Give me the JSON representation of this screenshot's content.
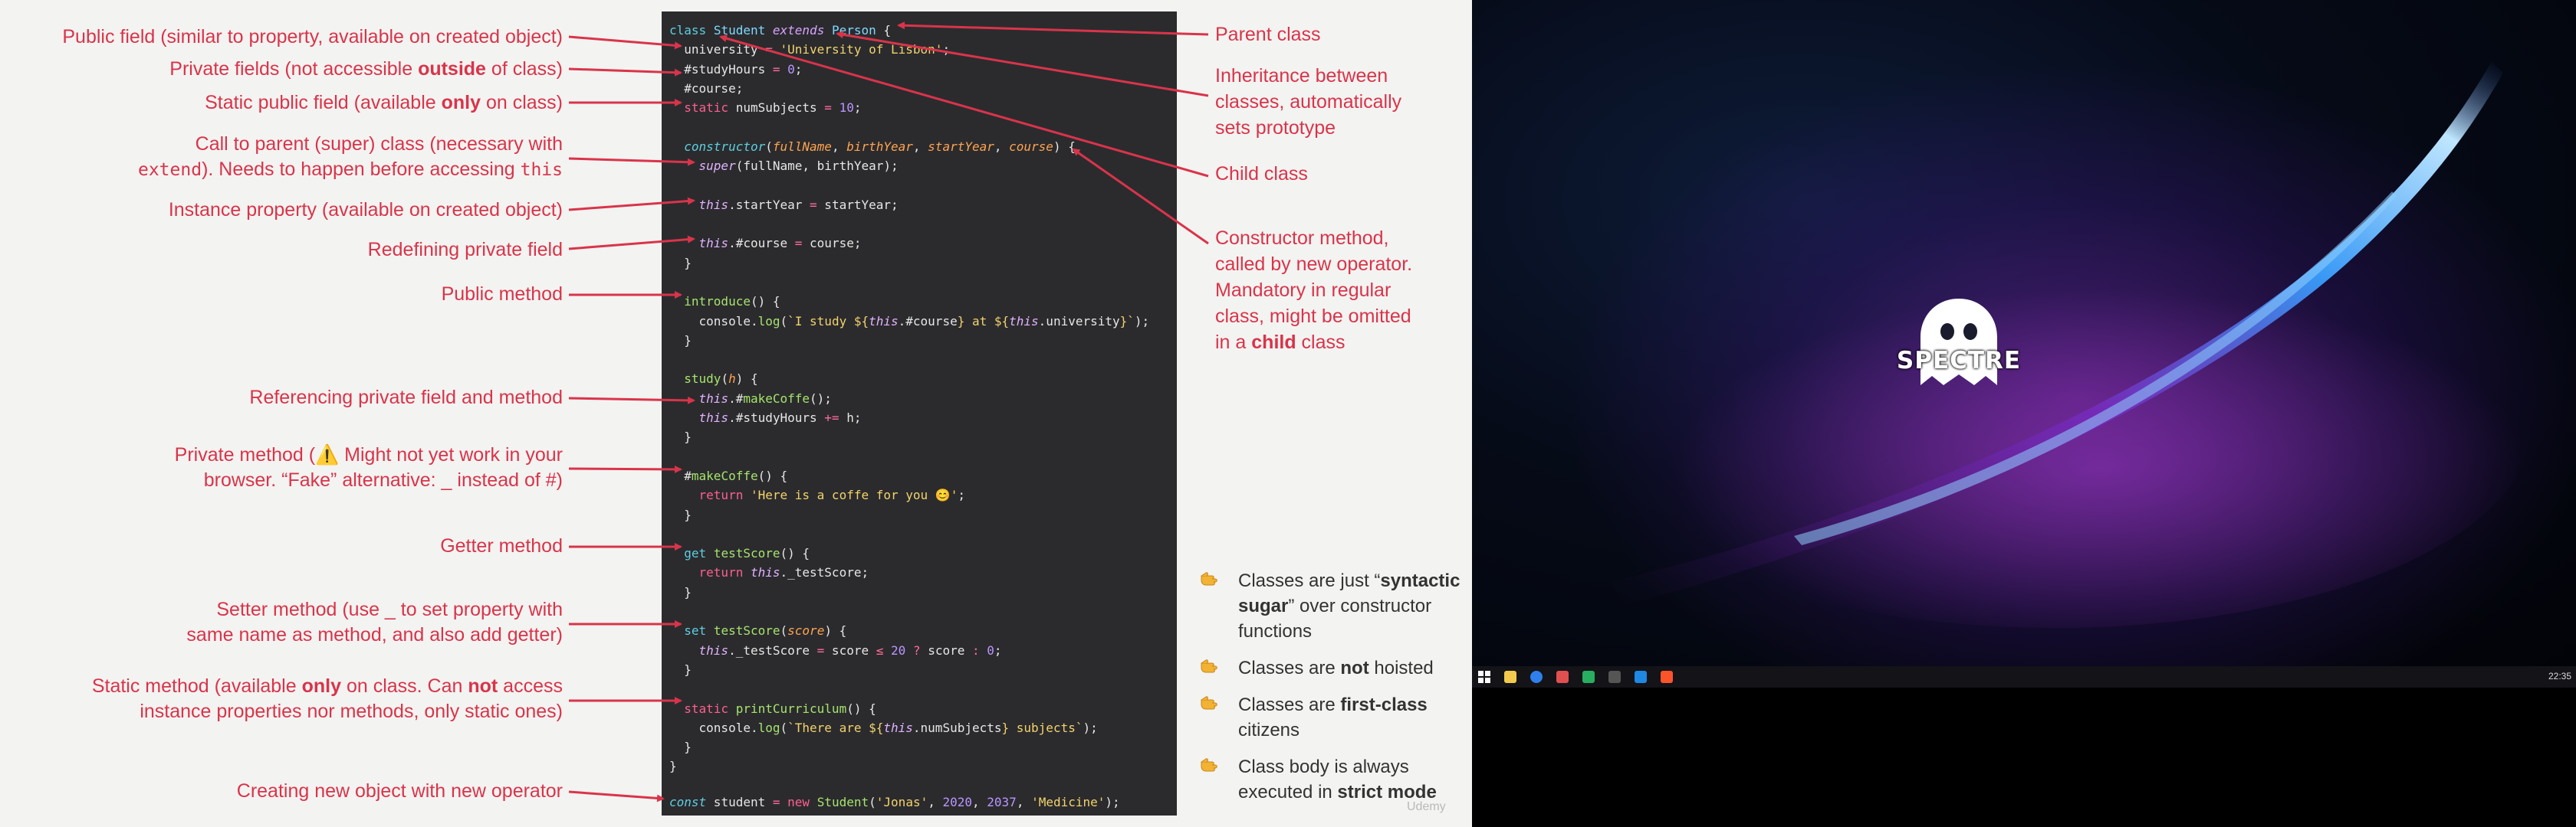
{
  "slide": {
    "left_labels": [
      {
        "name": "public-field",
        "html": "Public field (similar to property, available on created object)"
      },
      {
        "name": "private-fields",
        "html": "Private fields (not accessible <b>outside</b> of class)"
      },
      {
        "name": "static-public-field",
        "html": "Static public field (available <b>only</b> on class)"
      },
      {
        "name": "call-to-parent",
        "html": "Call to parent (super) class (necessary with<br><span class=\"mono\">extend</span>). Needs to happen before accessing <span class=\"mono\">this</span>"
      },
      {
        "name": "instance-property",
        "html": "Instance property (available on created object)"
      },
      {
        "name": "redefining-private",
        "html": "Redefining private field"
      },
      {
        "name": "public-method",
        "html": "Public method"
      },
      {
        "name": "referencing-private",
        "html": "Referencing private field and method"
      },
      {
        "name": "private-method",
        "html": "Private method (⚠️ Might not yet work in your<br>browser. “Fake” alternative: _ instead of #)"
      },
      {
        "name": "getter-method",
        "html": "Getter method"
      },
      {
        "name": "setter-method",
        "html": "Setter method (use _ to set property with<br>same name as method, and also add getter)"
      },
      {
        "name": "static-method",
        "html": "Static method (available <b>only</b> on class. Can <b>not</b> access<br>instance properties nor methods, only static ones)"
      },
      {
        "name": "creating-object",
        "html": "Creating new object with new operator"
      }
    ],
    "right_labels": [
      {
        "name": "parent-class",
        "html": "Parent class"
      },
      {
        "name": "inheritance",
        "html": "Inheritance between<br>classes, automatically<br>sets prototype"
      },
      {
        "name": "child-class",
        "html": "Child class"
      },
      {
        "name": "constructor-method",
        "html": "Constructor method,<br>called by new operator.<br>Mandatory in regular<br>class, might be omitted<br>in a <b>child</b> class"
      }
    ],
    "bullets": [
      {
        "name": "bullet-syntactic-sugar",
        "html": "Classes are just “<b>syntactic sugar</b>” over constructor functions"
      },
      {
        "name": "bullet-not-hoisted",
        "html": "Classes are <b>not</b> hoisted"
      },
      {
        "name": "bullet-first-class",
        "html": "Classes are <b>first-class</b> citizens"
      },
      {
        "name": "bullet-strict-mode",
        "html": "Class body is always executed in <b>strict mode</b>"
      }
    ],
    "watermark": "Udemy",
    "code_lines": [
      "<span class=\"t-kw\">class</span> <span class=\"t-cls\">Student</span> <span class=\"t-it\">extends</span> <span class=\"t-cls\">Person</span> {",
      "  university <span class=\"t-pink\">=</span> <span class=\"t-str\">'University of Lisbon'</span>;",
      "  #studyHours <span class=\"t-pink\">=</span> <span class=\"t-num\">0</span>;",
      "  #course;",
      "  <span class=\"t-kw2\">static</span> numSubjects <span class=\"t-pink\">=</span> <span class=\"t-num\">10</span>;",
      "",
      "  <span class=\"t-kw\" style=\"font-style:italic\">constructor</span>(<span class=\"t-param\">fullName</span>, <span class=\"t-param\">birthYear</span>, <span class=\"t-param\">startYear</span>, <span class=\"t-param\">course</span>) {",
      "    <span class=\"t-this\">super</span>(fullName, birthYear);",
      "",
      "    <span class=\"t-this\">this</span>.startYear <span class=\"t-pink\">=</span> startYear;",
      "",
      "    <span class=\"t-this\">this</span>.#course <span class=\"t-pink\">=</span> course;",
      "  }",
      "",
      "  <span class=\"t-fn\">introduce</span>() {",
      "    console.<span class=\"t-fn\">log</span>(<span class=\"t-str\">`I study ${</span><span class=\"t-this\">this</span>.#course<span class=\"t-str\">} at ${</span><span class=\"t-this\">this</span>.university<span class=\"t-str\">}`</span>);",
      "  }",
      "",
      "  <span class=\"t-fn\">study</span>(<span class=\"t-param\">h</span>) {",
      "    <span class=\"t-this\">this</span>.#<span class=\"t-fn\">makeCoffe</span>();",
      "    <span class=\"t-this\">this</span>.#studyHours <span class=\"t-pink\">+=</span> h;",
      "  }",
      "",
      "  #<span class=\"t-fn\">makeCoffe</span>() {",
      "    <span class=\"t-kw2\">return</span> <span class=\"t-str\">'Here is a coffe for you 😊'</span>;",
      "  }",
      "",
      "  <span class=\"t-kw\">get</span> <span class=\"t-fn\">testScore</span>() {",
      "    <span class=\"t-kw2\">return</span> <span class=\"t-this\">this</span>._testScore;",
      "  }",
      "",
      "  <span class=\"t-kw\">set</span> <span class=\"t-fn\">testScore</span>(<span class=\"t-param\">score</span>) {",
      "    <span class=\"t-this\">this</span>._testScore <span class=\"t-pink\">=</span> score <span class=\"t-pink\">≤</span> <span class=\"t-num\">20</span> <span class=\"t-pink\">?</span> score <span class=\"t-pink\">:</span> <span class=\"t-num\">0</span>;",
      "  }",
      "",
      "  <span class=\"t-kw2\">static</span> <span class=\"t-fn\">printCurriculum</span>() {",
      "    console.<span class=\"t-fn\">log</span>(<span class=\"t-str\">`There are ${</span><span class=\"t-this\">this</span>.numSubjects<span class=\"t-str\">} subjects`</span>);",
      "  }",
      "}",
      "",
      "<span class=\"t-it\" style=\"color:#5ecfe0\">const</span> student <span class=\"t-pink\">=</span> <span class=\"t-kw2\">new</span> <span class=\"t-fn\">Student</span>(<span class=\"t-str\">'Jonas'</span>, <span class=\"t-num\">2020</span>, <span class=\"t-num\">2037</span>, <span class=\"t-str\">'Medicine'</span>);"
    ]
  },
  "desktop": {
    "logo_text": "SPECTRE",
    "clock": "22:35",
    "taskbar_icons": [
      "windows-start-icon",
      "file-explorer-icon",
      "browser-icon",
      "media-icon",
      "spreadsheet-icon",
      "terminal-icon",
      "vscode-icon",
      "brave-icon"
    ]
  }
}
